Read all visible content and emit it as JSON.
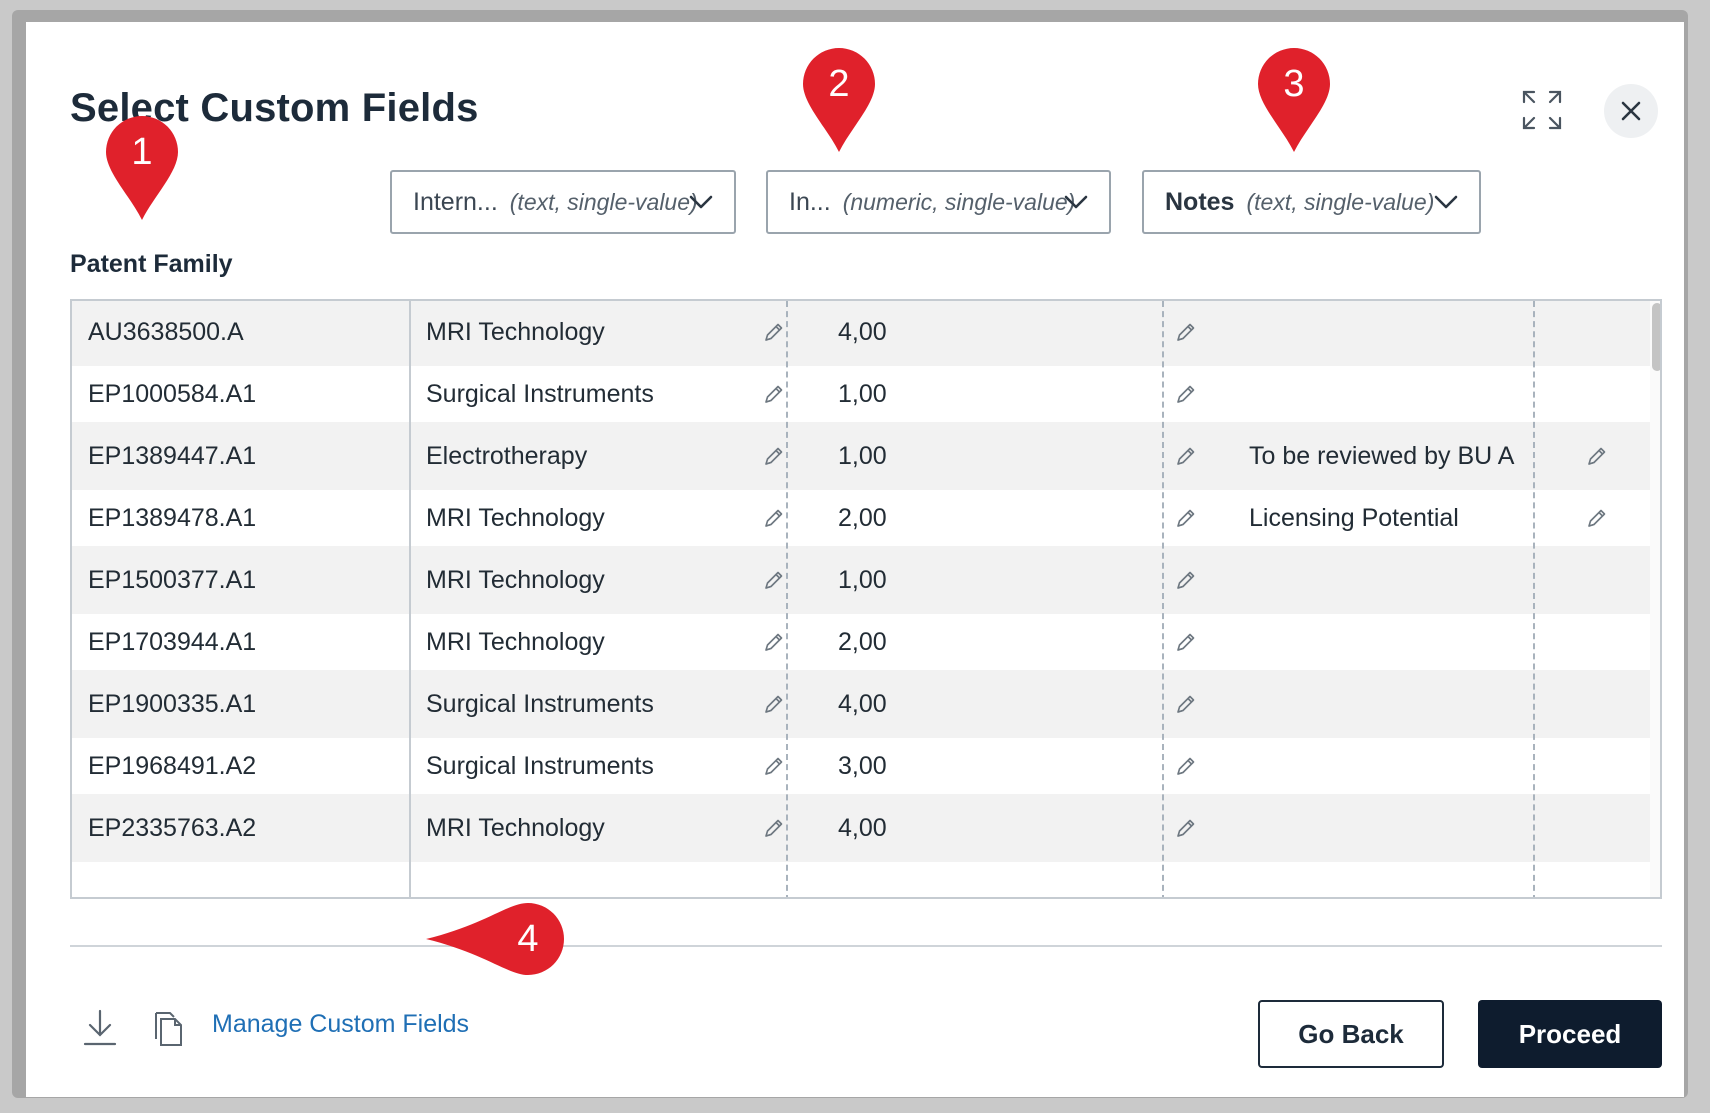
{
  "dialog": {
    "title": "Select Custom Fields",
    "patent_family_label": "Patent Family",
    "expand_icon": "expand-icon",
    "close_icon": "close-icon"
  },
  "field_selectors": [
    {
      "name": "Intern...",
      "type": "(text, single-value)",
      "bold": false
    },
    {
      "name": "In...",
      "type": "(numeric, single-value)",
      "bold": false
    },
    {
      "name": "Notes",
      "type": "(text, single-value)",
      "bold": true
    }
  ],
  "table": {
    "rows": [
      {
        "family": "AU3638500.A",
        "field1": "MRI Technology",
        "field2": "4,00",
        "field3": ""
      },
      {
        "family": "EP1000584.A1",
        "field1": "Surgical Instruments",
        "field2": "1,00",
        "field3": ""
      },
      {
        "family": "EP1389447.A1",
        "field1": "Electrotherapy",
        "field2": "1,00",
        "field3": "To be reviewed by BU A"
      },
      {
        "family": "EP1389478.A1",
        "field1": "MRI Technology",
        "field2": "2,00",
        "field3": "Licensing Potential"
      },
      {
        "family": "EP1500377.A1",
        "field1": "MRI Technology",
        "field2": "1,00",
        "field3": ""
      },
      {
        "family": "EP1703944.A1",
        "field1": "MRI Technology",
        "field2": "2,00",
        "field3": ""
      },
      {
        "family": "EP1900335.A1",
        "field1": "Surgical Instruments",
        "field2": "4,00",
        "field3": ""
      },
      {
        "family": "EP1968491.A2",
        "field1": "Surgical Instruments",
        "field2": "3,00",
        "field3": ""
      },
      {
        "family": "EP2335763.A2",
        "field1": "MRI Technology",
        "field2": "4,00",
        "field3": ""
      }
    ]
  },
  "footer": {
    "download_icon": "download-icon",
    "copy_icon": "copy-icon",
    "manage_link": "Manage Custom Fields",
    "go_back_label": "Go Back",
    "proceed_label": "Proceed"
  },
  "callouts": [
    "1",
    "2",
    "3",
    "4"
  ],
  "colors": {
    "callout_red": "#e0212b",
    "primary_button": "#0e1c2e",
    "link_blue": "#1f6fb5",
    "title_text": "#1d2b3a"
  }
}
